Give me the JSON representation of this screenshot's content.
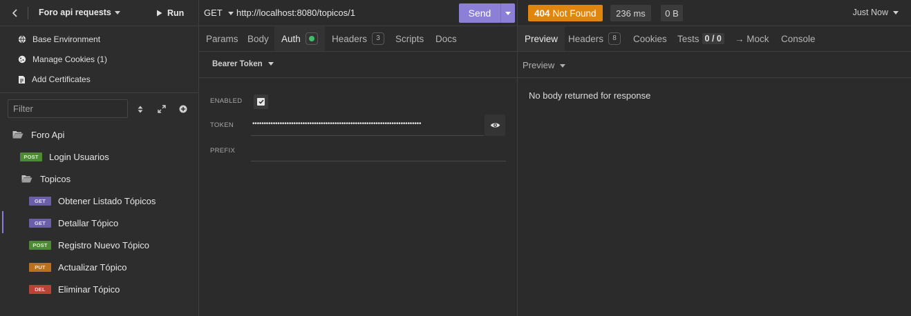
{
  "sidebar": {
    "project_name": "Foro api requests",
    "run_label": "Run",
    "menu": [
      {
        "label": "Base Environment",
        "icon": "globe-icon"
      },
      {
        "label": "Manage Cookies (1)",
        "icon": "cookie-icon"
      },
      {
        "label": "Add Certificates",
        "icon": "certificate-icon"
      }
    ],
    "filter_placeholder": "Filter",
    "tree": {
      "collection": "Foro Api",
      "login": {
        "method": "POST",
        "label": "Login Usuarios"
      },
      "folder": "Topicos",
      "requests": [
        {
          "method": "GET",
          "label": "Obtener Listado Tópicos"
        },
        {
          "method": "GET",
          "label": "Detallar Tópico",
          "active": true
        },
        {
          "method": "POST",
          "label": "Registro Nuevo Tópico"
        },
        {
          "method": "PUT",
          "label": "Actualizar Tópico"
        },
        {
          "method": "DEL",
          "label": "Eliminar Tópico"
        }
      ]
    }
  },
  "request": {
    "method": "GET",
    "url": "http://localhost:8080/topicos/1",
    "send_label": "Send",
    "tabs": {
      "params": "Params",
      "body": "Body",
      "auth": "Auth",
      "headers": "Headers",
      "headers_count": "3",
      "scripts": "Scripts",
      "docs": "Docs"
    },
    "auth": {
      "type": "Bearer Token",
      "enabled_label": "ENABLED",
      "enabled": true,
      "token_label": "TOKEN",
      "token_masked": "••••••••••••••••••••••••••••••••••••••••••••••••••••••••••••••••••••••••••",
      "prefix_label": "PREFIX"
    }
  },
  "response": {
    "status_code": "404",
    "status_text": "Not Found",
    "time": "236 ms",
    "size": "0 B",
    "timestamp": "Just Now",
    "tabs": {
      "preview": "Preview",
      "headers": "Headers",
      "headers_count": "8",
      "cookies": "Cookies",
      "tests": "Tests",
      "tests_count": "0 / 0",
      "mock": "→ Mock",
      "console": "Console"
    },
    "preview_mode": "Preview",
    "message": "No body returned for response"
  },
  "colors": {
    "accent": "#8c7fd6",
    "status_404": "#e0860f",
    "auth_enabled_dot": "#3fbf6a",
    "post": "#4e8a36",
    "get": "#6a5fa8",
    "put": "#b8711f",
    "delete": "#b84337"
  }
}
